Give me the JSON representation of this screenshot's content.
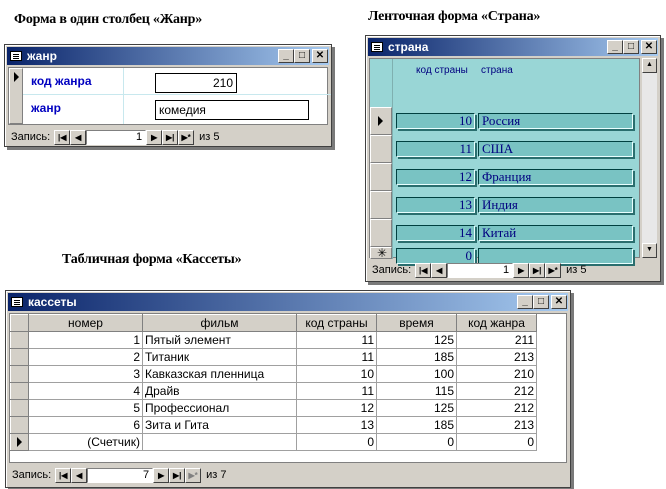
{
  "captions": {
    "form1": "Форма в один столбец «Жанр»",
    "form2": "Ленточная форма «Страна»",
    "form3": "Табличная форма «Кассеты»"
  },
  "icons": {
    "window": "form-icon",
    "minimize": "minimize-icon",
    "maximize": "maximize-icon",
    "close": "close-icon",
    "nav_first": "first-record-icon",
    "nav_prev": "prev-record-icon",
    "nav_next": "next-record-icon",
    "nav_last": "last-record-icon",
    "nav_new": "new-record-icon",
    "current_row": "current-row-icon",
    "new_row": "new-row-icon"
  },
  "genre_window": {
    "title": "жанр",
    "fields": [
      {
        "label": "код жанра",
        "value": "210"
      },
      {
        "label": "жанр",
        "value": "комедия"
      }
    ],
    "nav": {
      "label": "Запись:",
      "current": "1",
      "of": "из 5"
    }
  },
  "country_window": {
    "title": "страна",
    "headers": [
      "код страны",
      "страна"
    ],
    "rows": [
      {
        "code": "10",
        "name": "Россия"
      },
      {
        "code": "11",
        "name": "США"
      },
      {
        "code": "12",
        "name": "Франция"
      },
      {
        "code": "13",
        "name": "Индия"
      },
      {
        "code": "14",
        "name": "Китай"
      }
    ],
    "new_row": {
      "code": "0",
      "name": ""
    },
    "nav": {
      "label": "Запись:",
      "current": "1",
      "of": "из 5"
    }
  },
  "cassettes_window": {
    "title": "кассеты",
    "columns": [
      "номер",
      "фильм",
      "код страны",
      "время",
      "код жанра"
    ],
    "rows": [
      [
        "1",
        "Пятый элемент",
        "11",
        "125",
        "211"
      ],
      [
        "2",
        "Титаник",
        "11",
        "185",
        "213"
      ],
      [
        "3",
        "Кавказская пленница",
        "10",
        "100",
        "210"
      ],
      [
        "4",
        "Драйв",
        "11",
        "115",
        "212"
      ],
      [
        "5",
        "Профессионал",
        "12",
        "125",
        "212"
      ],
      [
        "6",
        "Зита и Гита",
        "13",
        "185",
        "213"
      ]
    ],
    "new_row": [
      "(Счетчик)",
      "",
      "0",
      "0",
      "0"
    ],
    "nav": {
      "label": "Запись:",
      "current": "7",
      "of": "из 7"
    }
  },
  "colors": {
    "titlebar_start": "#0a246a",
    "titlebar_end": "#a6caf0",
    "form1_label": "#0000c0",
    "form2_background": "#99d6d6",
    "form2_field": "#79c3c3",
    "form2_text": "#000080"
  }
}
